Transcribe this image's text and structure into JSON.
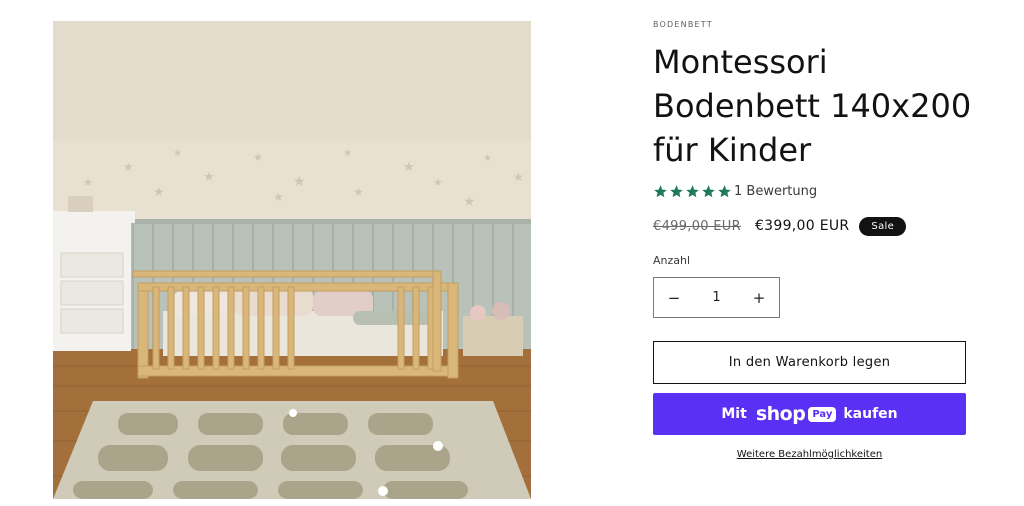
{
  "product": {
    "vendor": "BODENBETT",
    "title": "Montessori Bodenbett 140x200 für Kinder",
    "rating": {
      "stars": 5,
      "max_stars": 5,
      "count_label": "1 Bewertung",
      "star_color": "#1e7a5a"
    },
    "price": {
      "regular": "€499,00 EUR",
      "sale": "€399,00 EUR",
      "badge": "Sale"
    },
    "quantity": {
      "label": "Anzahl",
      "value": "1",
      "minus": "−",
      "plus": "+"
    },
    "add_to_cart": "In den Warenkorb legen",
    "shop_pay": {
      "prefix": "Mit",
      "brand": "shop",
      "badge": "Pay",
      "suffix": "kaufen",
      "color": "#5a31f4"
    },
    "more_payment": "Weitere Bezahlmöglichkeiten"
  }
}
